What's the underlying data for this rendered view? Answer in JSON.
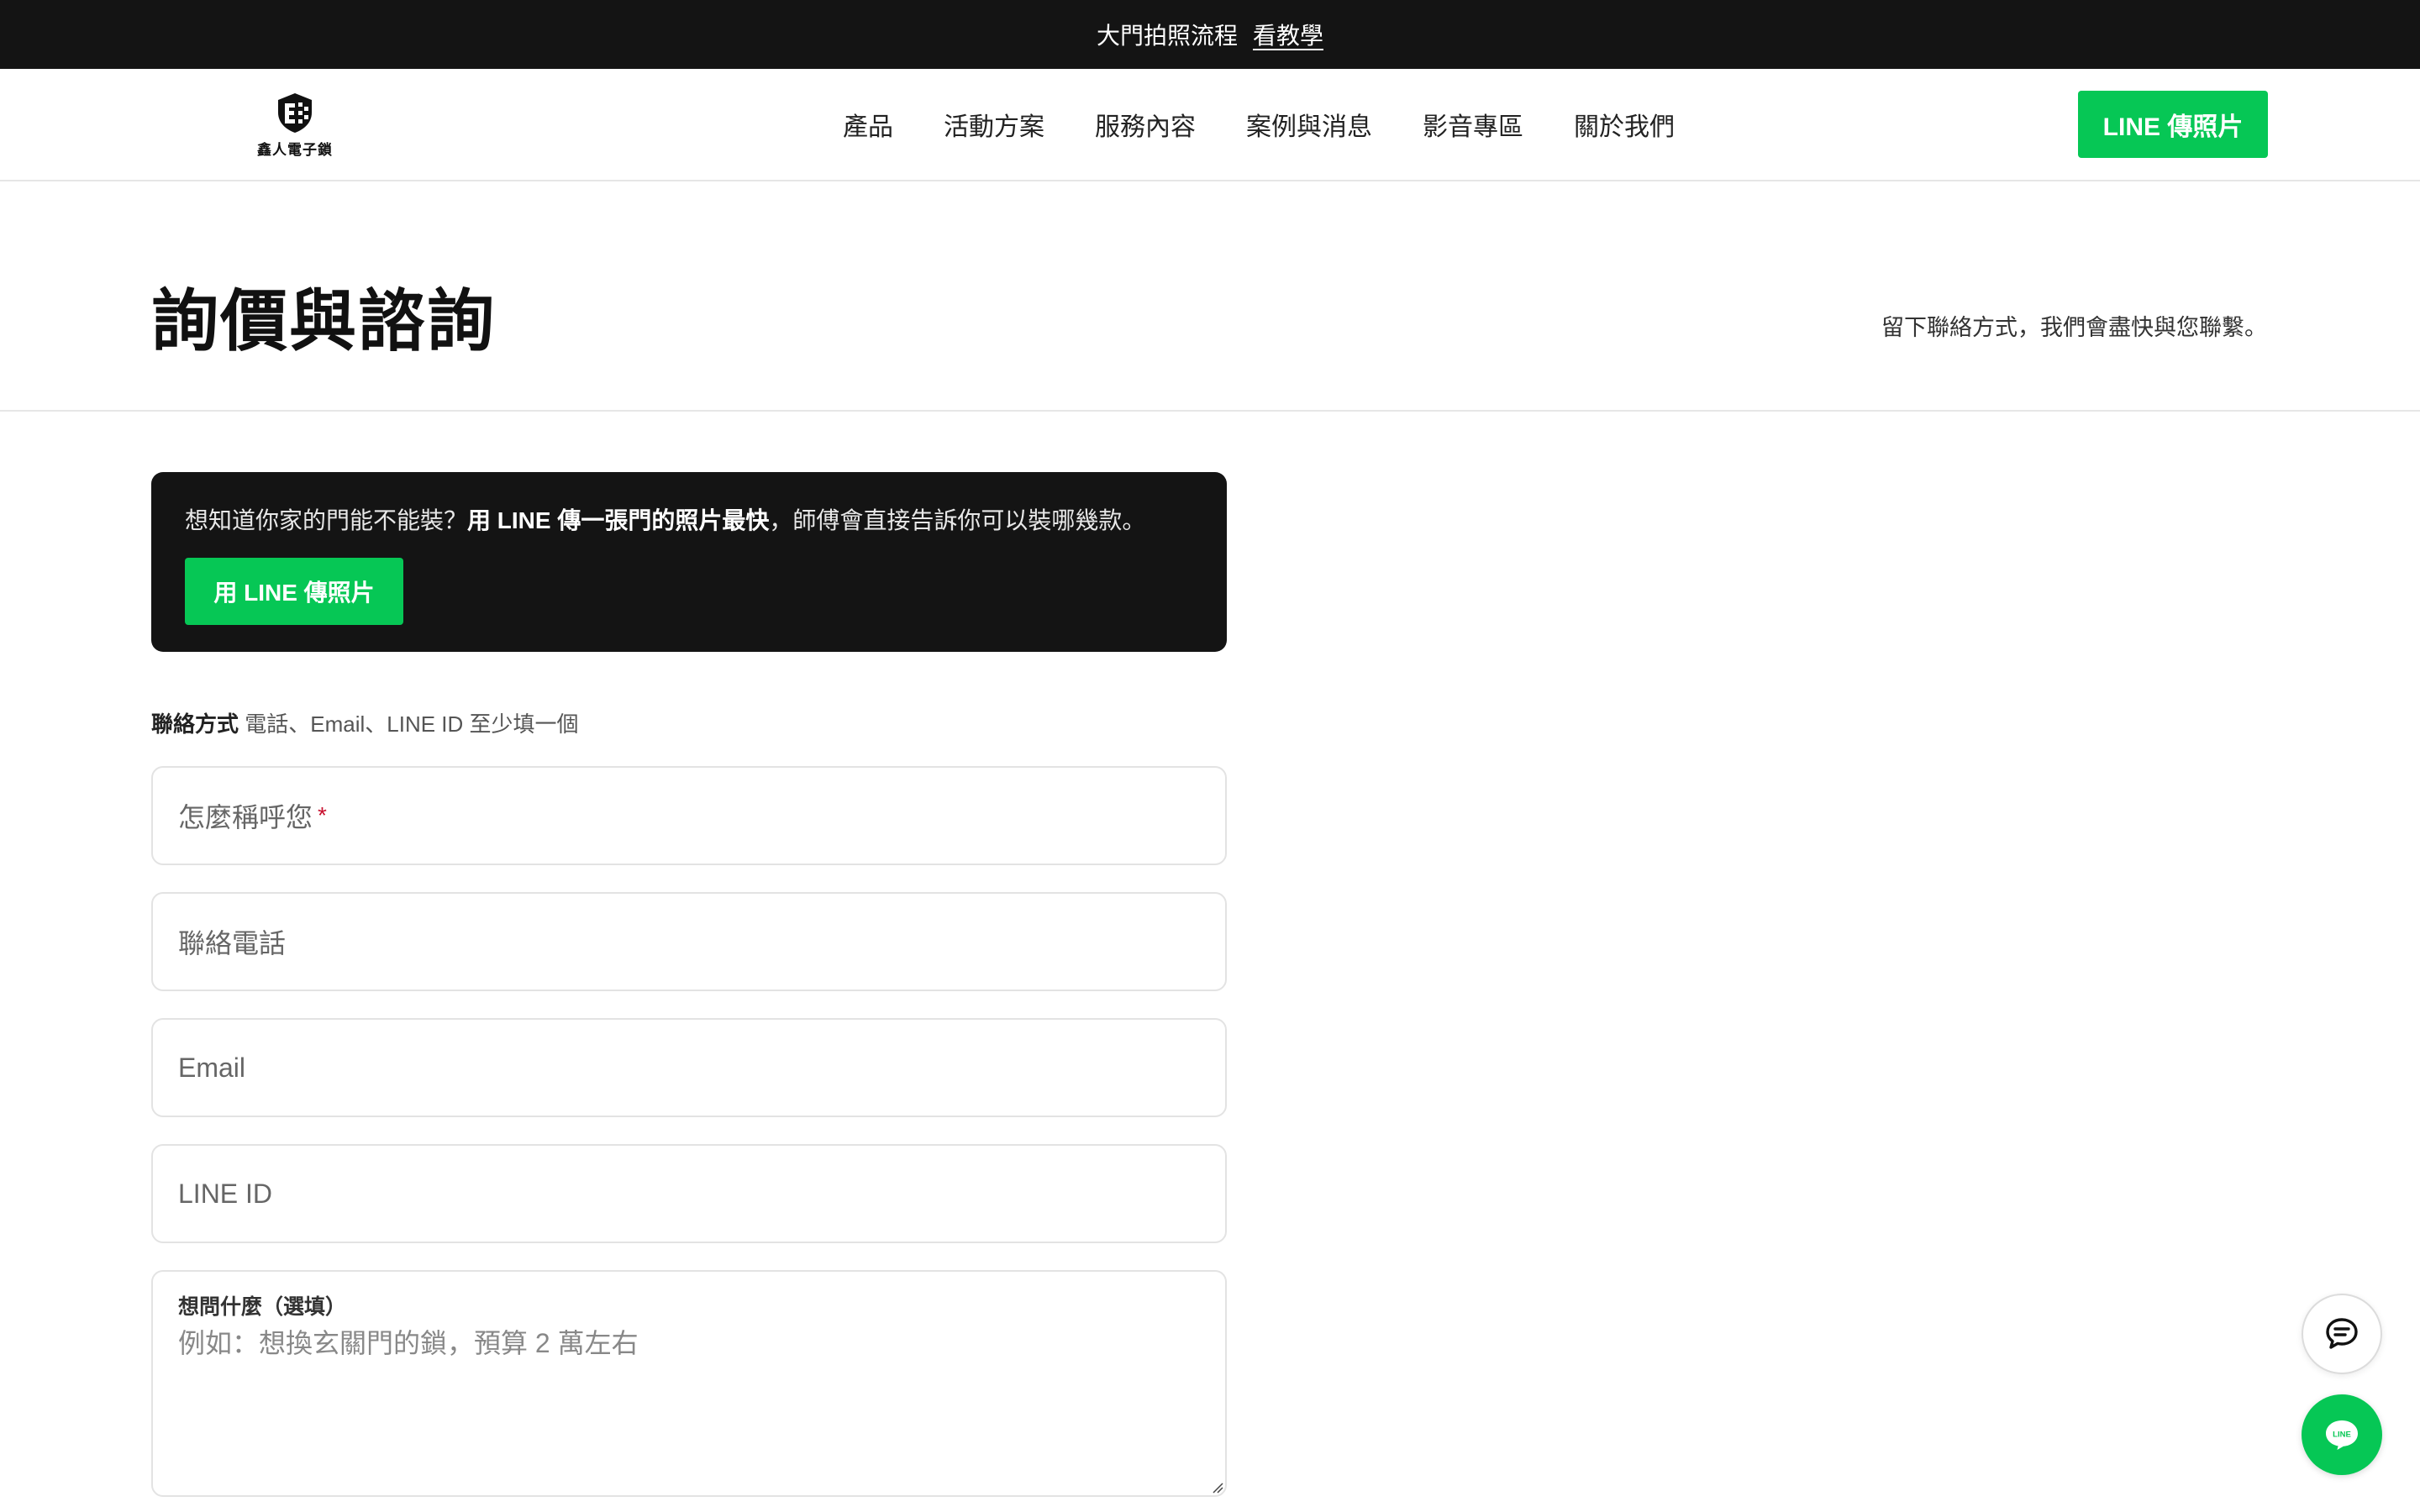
{
  "announcement": {
    "text": "大門拍照流程",
    "link": "看教學"
  },
  "header": {
    "logo_text": "鑫人電子鎖",
    "nav": [
      {
        "label": "產品"
      },
      {
        "label": "活動方案"
      },
      {
        "label": "服務內容"
      },
      {
        "label": "案例與消息"
      },
      {
        "label": "影音專區"
      },
      {
        "label": "關於我們"
      }
    ],
    "cta": "LINE 傳照片"
  },
  "page": {
    "title": "詢價與諮詢",
    "subtitle": "留下聯絡方式，我們會盡快與您聯繫。"
  },
  "callout": {
    "text_before": "想知道你家的門能不能裝？",
    "text_bold": "用 LINE 傳一張門的照片最快",
    "text_after": "，師傅會直接告訴你可以裝哪幾款。",
    "button": "用 LINE 傳照片"
  },
  "form": {
    "contact_label": "聯絡方式",
    "contact_hint": "電話、Email、LINE ID 至少填一個",
    "name_placeholder": "怎麼稱呼您",
    "required_mark": "*",
    "phone_placeholder": "聯絡電話",
    "email_placeholder": "Email",
    "line_placeholder": "LINE ID",
    "question_label": "想問什麼（選填）",
    "question_placeholder": "例如：想換玄關門的鎖，預算 2 萬左右"
  },
  "floating": {
    "chat_icon": "chat-bubble-icon",
    "line_icon": "line-icon",
    "line_label": "LINE"
  },
  "colors": {
    "accent": "#06c755",
    "dark": "#141414",
    "required": "#c8102e"
  }
}
